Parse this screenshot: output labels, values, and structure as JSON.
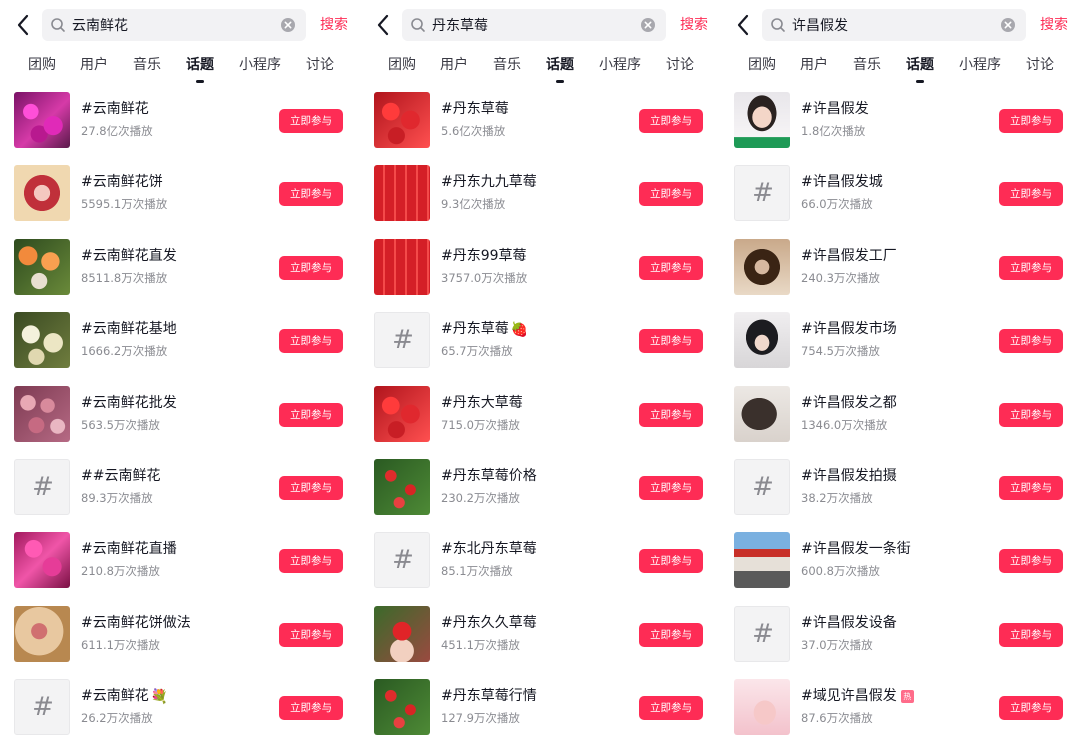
{
  "accent_color": "#fe2c55",
  "panels": [
    {
      "query": "云南鲜花",
      "search_label": "搜索",
      "tabs": [
        "团购",
        "用户",
        "音乐",
        "话题",
        "小程序",
        "讨论"
      ],
      "active_tab": "话题",
      "join_label": "立即参与",
      "items": [
        {
          "title": "#云南鲜花",
          "plays": "27.8亿次播放",
          "thumb": "magenta-flowers-photo"
        },
        {
          "title": "#云南鲜花饼",
          "plays": "5595.1万次播放",
          "thumb": "flower-cake-photo"
        },
        {
          "title": "#云南鲜花直发",
          "plays": "8511.8万次播放",
          "thumb": "orange-roses-photo"
        },
        {
          "title": "#云南鲜花基地",
          "plays": "1666.2万次播放",
          "thumb": "white-flowers-photo"
        },
        {
          "title": "#云南鲜花批发",
          "plays": "563.5万次播放",
          "thumb": "pink-roses-photo"
        },
        {
          "title": "##云南鲜花",
          "plays": "89.3万次播放",
          "thumb": "hash-icon"
        },
        {
          "title": "#云南鲜花直播",
          "plays": "210.8万次播放",
          "thumb": "pink-flowers-photo"
        },
        {
          "title": "#云南鲜花饼做法",
          "plays": "611.1万次播放",
          "thumb": "flower-cake-closeup-photo"
        },
        {
          "title": "#云南鲜花",
          "plays": "26.2万次播放",
          "thumb": "hash-icon",
          "emoji": "💐"
        }
      ]
    },
    {
      "query": "丹东草莓",
      "search_label": "搜索",
      "tabs": [
        "团购",
        "用户",
        "音乐",
        "话题",
        "小程序",
        "讨论"
      ],
      "active_tab": "话题",
      "join_label": "立即参与",
      "items": [
        {
          "title": "#丹东草莓",
          "plays": "5.6亿次播放",
          "thumb": "strawberry-photo"
        },
        {
          "title": "#丹东九九草莓",
          "plays": "9.3亿次播放",
          "thumb": "strawberry-box-photo"
        },
        {
          "title": "#丹东99草莓",
          "plays": "3757.0万次播放",
          "thumb": "strawberry-box-photo"
        },
        {
          "title": "#丹东草莓",
          "plays": "65.7万次播放",
          "thumb": "hash-icon",
          "emoji": "🍓"
        },
        {
          "title": "#丹东大草莓",
          "plays": "715.0万次播放",
          "thumb": "strawberry-photo"
        },
        {
          "title": "#丹东草莓价格",
          "plays": "230.2万次播放",
          "thumb": "strawberry-field-photo"
        },
        {
          "title": "#东北丹东草莓",
          "plays": "85.1万次播放",
          "thumb": "hash-icon"
        },
        {
          "title": "#丹东久久草莓",
          "plays": "451.1万次播放",
          "thumb": "strawberry-held-photo"
        },
        {
          "title": "#丹东草莓行情",
          "plays": "127.9万次播放",
          "thumb": "strawberry-field-photo"
        }
      ]
    },
    {
      "query": "许昌假发",
      "search_label": "搜索",
      "tabs": [
        "团购",
        "用户",
        "音乐",
        "话题",
        "小程序",
        "讨论"
      ],
      "active_tab": "话题",
      "join_label": "立即参与",
      "items": [
        {
          "title": "#许昌假发",
          "plays": "1.8亿次播放",
          "thumb": "woman-portrait-photo"
        },
        {
          "title": "#许昌假发城",
          "plays": "66.0万次播放",
          "thumb": "hash-icon"
        },
        {
          "title": "#许昌假发工厂",
          "plays": "240.3万次播放",
          "thumb": "curly-wig-photo"
        },
        {
          "title": "#许昌假发市场",
          "plays": "754.5万次播放",
          "thumb": "bangs-wig-photo"
        },
        {
          "title": "#许昌假发之都",
          "plays": "1346.0万次播放",
          "thumb": "long-hair-photo"
        },
        {
          "title": "#许昌假发拍摄",
          "plays": "38.2万次播放",
          "thumb": "hash-icon"
        },
        {
          "title": "#许昌假发一条街",
          "plays": "600.8万次播放",
          "thumb": "street-shops-photo"
        },
        {
          "title": "#许昌假发设备",
          "plays": "37.0万次播放",
          "thumb": "hash-icon"
        },
        {
          "title": "#域见许昌假发",
          "plays": "87.6万次播放",
          "thumb": "pink-poster-photo",
          "badge": "热"
        }
      ]
    }
  ]
}
